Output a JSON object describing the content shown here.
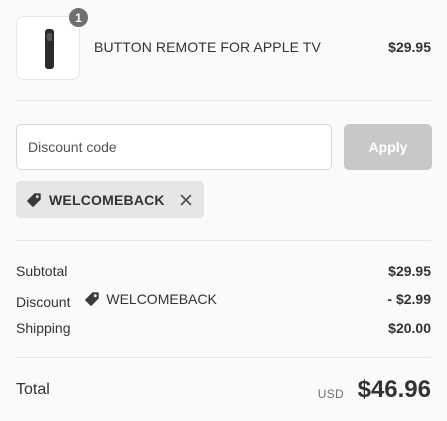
{
  "product": {
    "name": "BUTTON REMOTE FOR APPLE TV",
    "price": "$29.95",
    "quantity": "1"
  },
  "discount": {
    "placeholder": "Discount code",
    "value": "",
    "apply_label": "Apply",
    "applied_code": "WELCOMEBACK"
  },
  "totals": {
    "subtotal_label": "Subtotal",
    "subtotal_value": "$29.95",
    "discount_label": "Discount",
    "discount_code": "WELCOMEBACK",
    "discount_value": "- $2.99",
    "shipping_label": "Shipping",
    "shipping_value": "$20.00",
    "total_label": "Total",
    "currency": "USD",
    "total_value": "$46.96"
  },
  "icons": {
    "tag": "tag-icon",
    "remove": "close-icon"
  },
  "colors": {
    "apply_button_disabled": "#c8c8c8",
    "tag_background": "#e6e6e6",
    "text": "#333333"
  }
}
